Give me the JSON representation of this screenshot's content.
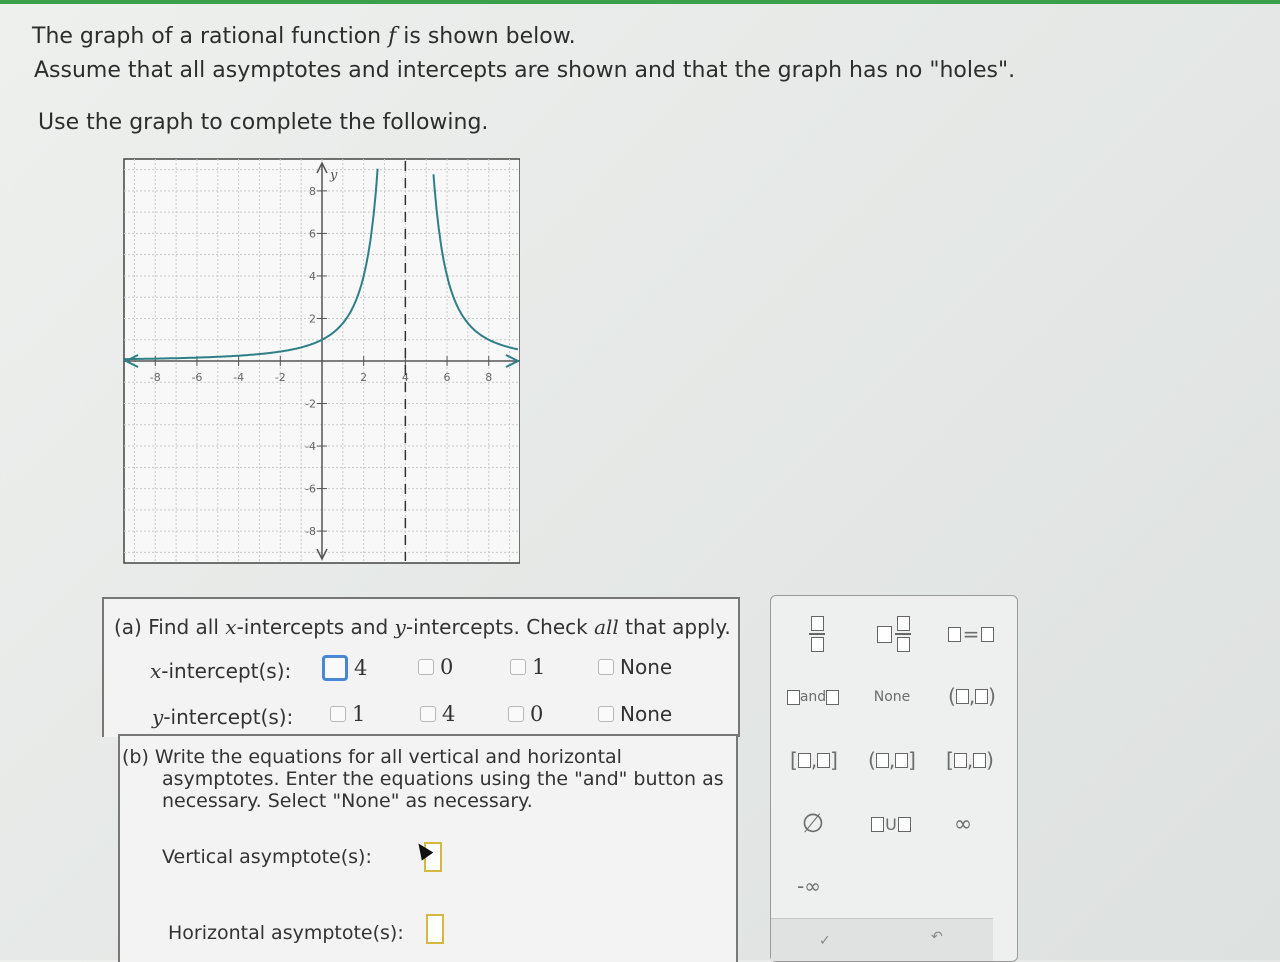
{
  "question": {
    "line1_part1": "The graph of a rational function",
    "line1_var": "f",
    "line1_part2": "is shown below.",
    "line2": "Assume that all asymptotes and intercepts are shown and that the graph has no \"holes\".",
    "line3": "Use the graph to complete the following."
  },
  "graph": {
    "x_axis_label": "",
    "y_axis_label": "y",
    "x_ticks": [
      "-8",
      "-6",
      "-4",
      "-2",
      "2",
      "4",
      "6",
      "8"
    ],
    "y_ticks": [
      "8",
      "6",
      "4",
      "2",
      "-2",
      "-4",
      "-6",
      "-8"
    ],
    "vertical_asymptote_x": 4,
    "horizontal_asymptote_y": 0,
    "curve_color": "#2f7f88"
  },
  "part_a": {
    "title_prefix": "(a) Find all",
    "x_var": "x",
    "mid": "-intercepts and",
    "y_var": "y",
    "title_suffix_1": "-intercepts. Check",
    "all_word": "all",
    "title_suffix_2": "that apply.",
    "x_row_var": "x",
    "x_row_label": "-intercept(s):",
    "y_row_var": "y",
    "y_row_label": "-intercept(s):",
    "x_options": [
      "4",
      "0",
      "1",
      "None"
    ],
    "y_options": [
      "1",
      "4",
      "0",
      "None"
    ]
  },
  "part_b": {
    "line1": "(b) Write the equations for all vertical and horizontal",
    "line2": "asymptotes. Enter the equations using the \"and\" button as",
    "line3": "necessary. Select \"None\" as necessary.",
    "vertical_label": "Vertical asymptote(s):",
    "horizontal_label": "Horizontal asymptote(s):",
    "vertical_value": "",
    "horizontal_value": ""
  },
  "keypad": {
    "and_label": "and",
    "none_label": "None",
    "empty_set": "∅",
    "union": "U",
    "infinity": "∞",
    "neg_infinity": "-∞"
  }
}
